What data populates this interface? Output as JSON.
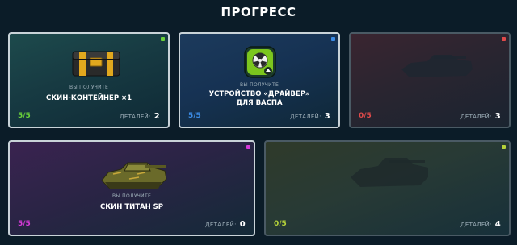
{
  "title": "ПРОГРЕСС",
  "parts_label": "ДЕТАЛЕЙ:",
  "receive_label": "ВЫ ПОЛУЧИТЕ",
  "cards": [
    {
      "progress": "5/5",
      "parts": "2",
      "reward_lines": [
        "СКИН-КОНТЕЙНЕР ×1"
      ],
      "reward_icon": "skin-container-icon",
      "accent": "#6ad13a",
      "locked": false
    },
    {
      "progress": "5/5",
      "parts": "3",
      "reward_lines": [
        "УСТРОЙСТВО «ДРАЙВЕР»",
        "ДЛЯ ВАСПА"
      ],
      "reward_icon": "driver-device-icon",
      "accent": "#3c8ce6",
      "locked": false
    },
    {
      "progress": "0/5",
      "parts": "3",
      "reward_icon": "tank-silhouette-icon",
      "accent": "#e04a4a",
      "locked": true
    },
    {
      "progress": "5/5",
      "parts": "0",
      "reward_lines": [
        "СКИН ТИТАН SP"
      ],
      "reward_icon": "titan-sp-tank-icon",
      "accent": "#d53ad8",
      "locked": false
    },
    {
      "progress": "0/5",
      "parts": "4",
      "reward_icon": "tank-silhouette-icon",
      "accent": "#b6d33a",
      "locked": true
    }
  ]
}
